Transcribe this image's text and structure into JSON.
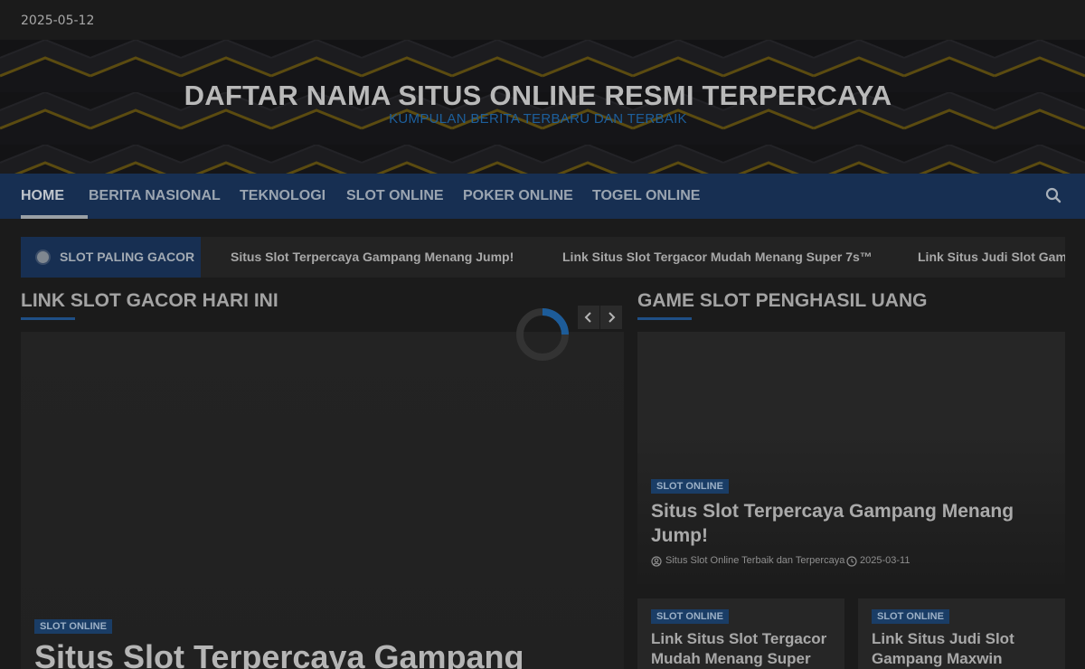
{
  "topbar": {
    "date": "2025-05-12"
  },
  "header": {
    "site_title": "DAFTAR NAMA SITUS ONLINE RESMI TERPERCAYA",
    "tagline": "KUMPULAN BERITA TERBARU DAN TERBAIK"
  },
  "nav": {
    "items": [
      {
        "label": "HOME"
      },
      {
        "label": "BERITA NASIONAL"
      },
      {
        "label": "TEKNOLOGI"
      },
      {
        "label": "SLOT ONLINE"
      },
      {
        "label": "POKER ONLINE"
      },
      {
        "label": "TOGEL ONLINE"
      }
    ],
    "search_icon": "search-icon"
  },
  "ticker": {
    "label": "SLOT PALING GACOR",
    "items": [
      "Situs Slot Terpercaya Gampang Menang Jump!",
      "Link Situs Slot Tergacor Mudah Menang Super 7s™",
      "Link Situs Judi Slot Gampang Maxwin"
    ]
  },
  "left_section": {
    "title": "LINK SLOT GACOR HARI INI",
    "prev_icon": "chevron-left-icon",
    "next_icon": "chevron-right-icon",
    "card": {
      "badge": "SLOT ONLINE",
      "title": "Situs Slot Terpercaya Gampang"
    }
  },
  "right_section": {
    "title": "GAME SLOT PENGHASIL UANG",
    "feature": {
      "badge": "SLOT ONLINE",
      "title": "Situs Slot Terpercaya Gampang Menang Jump!",
      "author": "Situs Slot Online Terbaik dan Terpercaya",
      "date": "2025-03-11"
    },
    "cards": [
      {
        "badge": "SLOT ONLINE",
        "title": "Link Situs Slot Tergacor Mudah Menang Super"
      },
      {
        "badge": "SLOT ONLINE",
        "title": "Link Situs Judi Slot Gampang Maxwin"
      }
    ]
  },
  "colors": {
    "background": "#1b1b1b",
    "nav": "#172f52",
    "accent": "#1f4f86",
    "tagline": "#1d5f9c"
  }
}
